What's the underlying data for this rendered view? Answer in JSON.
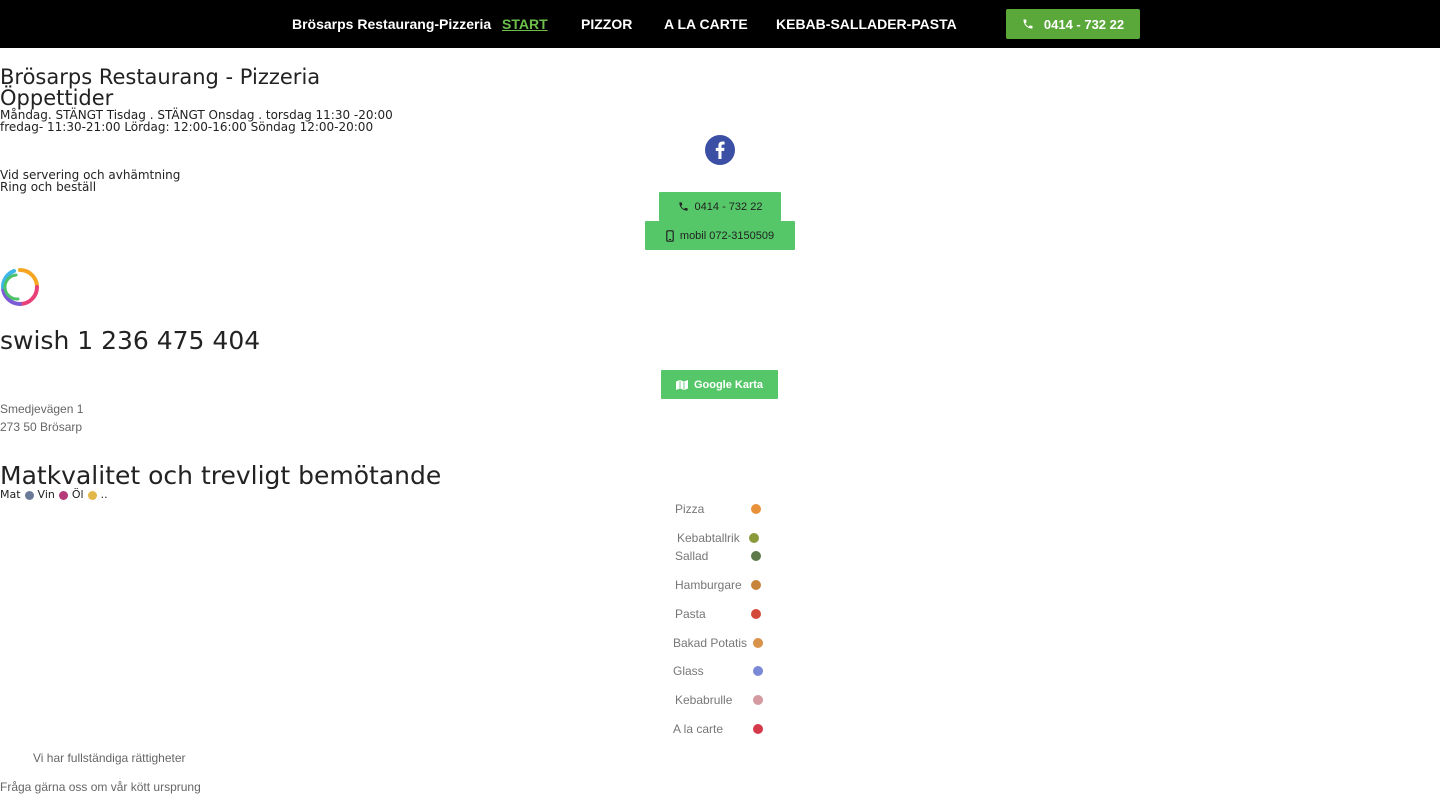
{
  "nav": {
    "brand": "Brösarps Restaurang-Pizzeria",
    "links": [
      "START",
      "PIZZOR",
      "A LA CARTE",
      "KEBAB-SALLADER-PASTA"
    ],
    "phone": "0414 - 732 22"
  },
  "info": {
    "title": "Brösarps Restaurang - Pizzeria",
    "hours_heading": "Öppettider",
    "hours_line1": "Måndag. STÄNGT Tisdag . STÄNGT Onsdag . torsdag 11:30 -20:00",
    "hours_line2": "fredag- 11:30-21:00 Lördag: 12:00-16:00 Söndag 12:00-20:00",
    "service_line1": "Vid servering och avhämtning",
    "service_line2": "Ring och beställ"
  },
  "contact": {
    "phone_button": "0414 - 732 22",
    "mobile_button": "mobil 072-3150509",
    "map_button": "Google Karta"
  },
  "swish": {
    "text": "swish 1 236 475 404"
  },
  "address": {
    "street": "Smedjevägen 1",
    "city": "273 50 Brösarp"
  },
  "quality": {
    "heading": "Matkvalitet och trevligt bemötande",
    "tagline_mat": "Mat",
    "tagline_vin": "Vin",
    "tagline_ol": "Öl",
    "tagline_end": ".."
  },
  "menu_items": [
    "Pizza",
    "Kebabtallrik",
    "Sallad",
    "Hamburgare",
    "Pasta",
    "Bakad Potatis",
    "Glass",
    "Kebabrulle",
    "A la carte"
  ],
  "footer": {
    "rights": "Vi har fullständiga rättigheter",
    "origin": "Fråga gärna oss om vår kött ursprung"
  },
  "colors": {
    "nav_bg": "#000000",
    "accent_green": "#55c768",
    "active_link": "#6cc04a",
    "facebook": "#3b4fa5"
  }
}
